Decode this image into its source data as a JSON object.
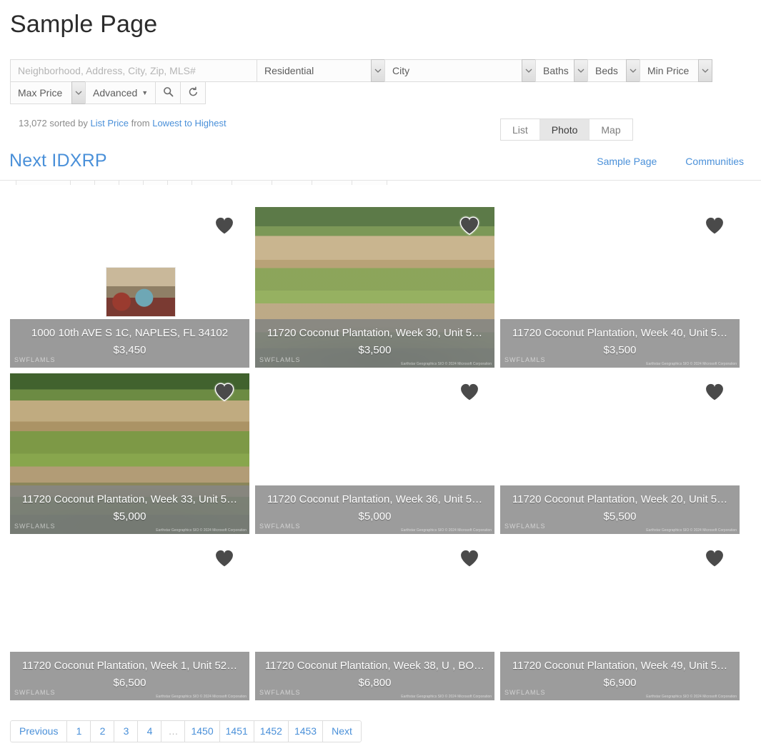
{
  "page": {
    "title": "Sample Page"
  },
  "search": {
    "keyword_placeholder": "Neighborhood, Address, City, Zip, MLS#",
    "keyword_value": "",
    "property_type": "Residential",
    "location": "City",
    "baths": "Baths",
    "beds": "Beds",
    "min_price": "Min Price",
    "max_price": "Max Price",
    "advanced_label": "Advanced",
    "search_icon": "magnifier-icon",
    "reset_icon": "reset-arrow-icon",
    "caret_icon": "chevron-down-icon"
  },
  "results": {
    "count": "13,072",
    "sorted_by_prefix": "sorted by",
    "sort_field": "List Price",
    "from_word": "from",
    "sort_order": "Lowest to Highest"
  },
  "view_toggle": {
    "options": [
      "List",
      "Photo",
      "Map"
    ],
    "active": "Photo"
  },
  "navbar": {
    "brand": "Next IDXRP",
    "links": [
      "Sample Page",
      "Communities"
    ]
  },
  "colors": {
    "link": "#4a90d9",
    "caption_bg": "#868686",
    "muted_text": "#8b8b8b"
  },
  "listings": [
    {
      "address": "1000 10th AVE S 1C, NAPLES, FL 34102",
      "price": "$3,450",
      "watermark": "SWFLAMLS",
      "attribution": "",
      "style": "thumb"
    },
    {
      "address": "11720 Coconut Plantation, Week 30, Unit 5…",
      "price": "$3,500",
      "watermark": "SWFLAMLS",
      "attribution": "Earthstar Geographics SIO © 2024 Microsoft Corporation",
      "style": "waterfall"
    },
    {
      "address": "11720 Coconut Plantation, Week 40, Unit 5…",
      "price": "$3,500",
      "watermark": "SWFLAMLS",
      "attribution": "Earthstar Geographics SIO © 2024 Microsoft Corporation",
      "style": "aerial"
    },
    {
      "address": "11720 Coconut Plantation, Week 33, Unit 5…",
      "price": "$5,000",
      "watermark": "SWFLAMLS",
      "attribution": "Earthstar Geographics SIO © 2024 Microsoft Corporation",
      "style": "waterfall2"
    },
    {
      "address": "11720 Coconut Plantation, Week 36, Unit 5…",
      "price": "$5,000",
      "watermark": "SWFLAMLS",
      "attribution": "Earthstar Geographics SIO © 2024 Microsoft Corporation",
      "style": "aerial"
    },
    {
      "address": "11720 Coconut Plantation, Week 20, Unit 5…",
      "price": "$5,500",
      "watermark": "SWFLAMLS",
      "attribution": "Earthstar Geographics SIO © 2024 Microsoft Corporation",
      "style": "aerial"
    },
    {
      "address": "11720 Coconut Plantation, Week 1, Unit 52…",
      "price": "$6,500",
      "watermark": "SWFLAMLS",
      "attribution": "Earthstar Geographics SIO © 2024 Microsoft Corporation",
      "style": "aerial"
    },
    {
      "address": "11720 Coconut Plantation, Week 38, U , BO…",
      "price": "$6,800",
      "watermark": "SWFLAMLS",
      "attribution": "Earthstar Geographics SIO © 2024 Microsoft Corporation",
      "style": "aerial"
    },
    {
      "address": "11720 Coconut Plantation, Week 49, Unit 5…",
      "price": "$6,900",
      "watermark": "SWFLAMLS",
      "attribution": "Earthstar Geographics SIO © 2024 Microsoft Corporation",
      "style": "aerial"
    }
  ],
  "pagination": {
    "previous": "Previous",
    "next": "Next",
    "pages": [
      "1",
      "2",
      "3",
      "4",
      "…",
      "1450",
      "1451",
      "1452",
      "1453"
    ]
  }
}
